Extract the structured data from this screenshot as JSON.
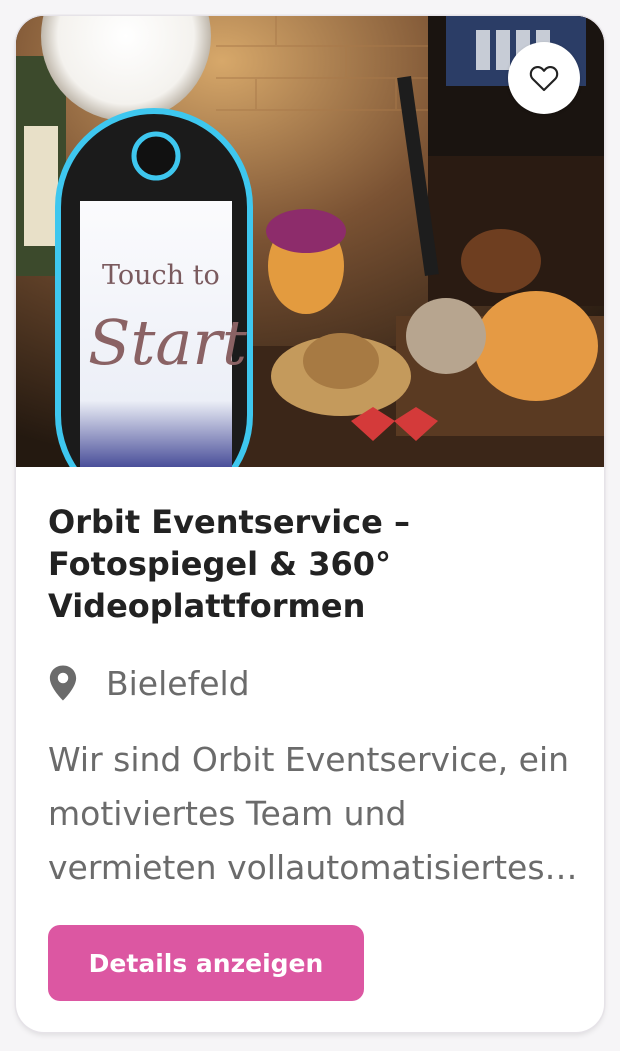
{
  "listing": {
    "title": "Orbit Eventservice – Fotospiegel & 360° Videoplattformen",
    "location": "Bielefeld",
    "description": "Wir sind Orbit Eventservice, ein motiviertes Team und vermieten vollautomatisiertes Equipment für Ihr Event.",
    "details_button": "Details anzeigen",
    "photo_sign_line1": "Touch to",
    "photo_sign_line2": "Start",
    "favorite_icon": "heart-outline-icon",
    "location_icon": "map-pin-icon"
  },
  "colors": {
    "accent": "#dc57a2",
    "title_text": "#222222",
    "muted_text": "#6b6b6b",
    "mirror_glow": "#3ec7ef"
  }
}
